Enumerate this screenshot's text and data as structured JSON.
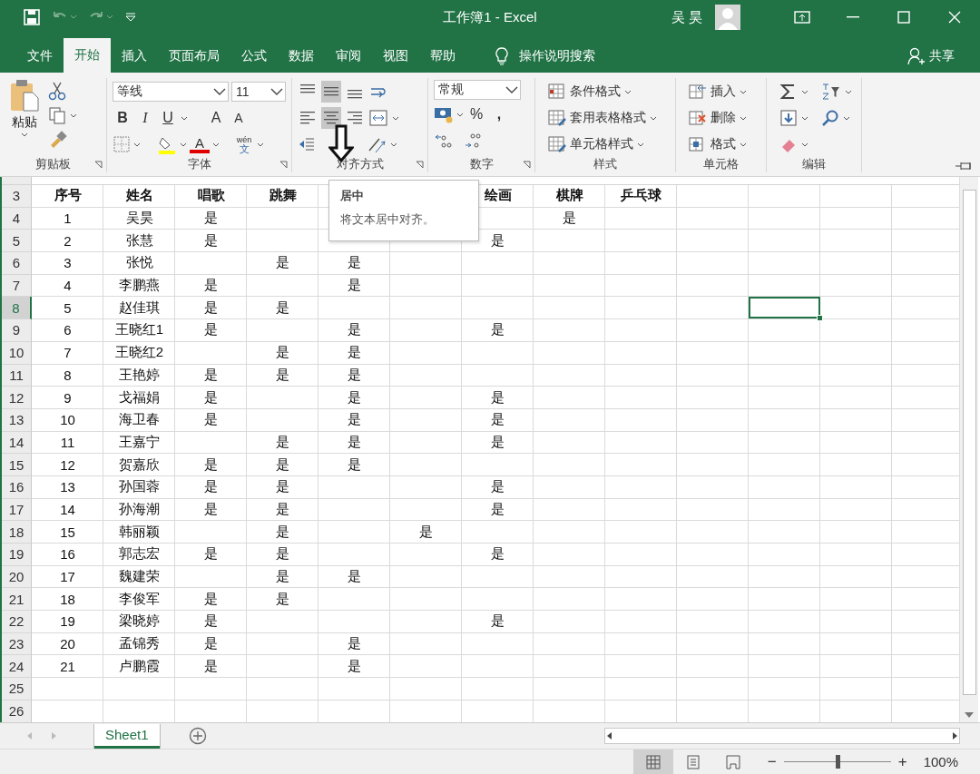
{
  "title_bar": {
    "title": "工作簿1 - Excel",
    "user": "吴昊"
  },
  "menu_tabs": [
    {
      "label": "文件",
      "selected": false
    },
    {
      "label": "开始",
      "selected": true
    },
    {
      "label": "插入",
      "selected": false
    },
    {
      "label": "页面布局",
      "selected": false
    },
    {
      "label": "公式",
      "selected": false
    },
    {
      "label": "数据",
      "selected": false
    },
    {
      "label": "审阅",
      "selected": false
    },
    {
      "label": "视图",
      "selected": false
    },
    {
      "label": "帮助",
      "selected": false
    }
  ],
  "tell_me": "操作说明搜索",
  "share": "共享",
  "ribbon": {
    "clipboard": {
      "label": "剪贴板",
      "paste": "粘贴"
    },
    "font": {
      "label": "字体",
      "font_name": "等线",
      "font_size": "11",
      "bold": "B",
      "italic": "I",
      "underline": "U",
      "grow": "A",
      "shrink": "A",
      "font_color": "A",
      "phonetic_top": "wén",
      "phonetic_bottom": "文"
    },
    "alignment": {
      "label": "对齐方式",
      "vertical": [
        {
          "selected": false
        },
        {
          "selected": true
        },
        {
          "selected": false
        }
      ],
      "horizontal": [
        {
          "selected": false
        },
        {
          "selected": true
        },
        {
          "selected": false
        }
      ]
    },
    "number": {
      "label": "数字",
      "format": "常规",
      "percent": "%",
      "comma": ","
    },
    "styles": {
      "label": "样式",
      "items": [
        "条件格式",
        "套用表格格式",
        "单元格样式"
      ]
    },
    "cells": {
      "label": "单元格",
      "items": [
        "插入",
        "删除",
        "格式"
      ]
    },
    "editing": {
      "label": "编辑"
    }
  },
  "sheet": {
    "header": {
      "label": "3",
      "selected": false,
      "cells": {
        "A": "序号",
        "B": "姓名",
        "C": "唱歌",
        "D": "跳舞",
        "G": "绘画",
        "H": "棋牌",
        "I": "乒乓球"
      }
    },
    "rows": [
      {
        "label": "4",
        "selected": false,
        "cells": {
          "A": "1",
          "B": "吴昊",
          "C": "是",
          "H": "是"
        }
      },
      {
        "label": "5",
        "selected": false,
        "cells": {
          "A": "2",
          "B": "张慧",
          "C": "是",
          "G": "是"
        }
      },
      {
        "label": "6",
        "selected": false,
        "cells": {
          "A": "3",
          "B": "张悦",
          "D": "是",
          "E": "是"
        }
      },
      {
        "label": "7",
        "selected": false,
        "cells": {
          "A": "4",
          "B": "李鹏燕",
          "C": "是",
          "E": "是"
        }
      },
      {
        "label": "8",
        "selected": true,
        "cells": {
          "A": "5",
          "B": "赵佳琪",
          "C": "是",
          "D": "是"
        }
      },
      {
        "label": "9",
        "selected": false,
        "cells": {
          "A": "6",
          "B": "王晓红1",
          "C": "是",
          "E": "是",
          "G": "是"
        }
      },
      {
        "label": "10",
        "selected": false,
        "cells": {
          "A": "7",
          "B": "王晓红2",
          "D": "是",
          "E": "是"
        }
      },
      {
        "label": "11",
        "selected": false,
        "cells": {
          "A": "8",
          "B": "王艳婷",
          "C": "是",
          "D": "是",
          "E": "是"
        }
      },
      {
        "label": "12",
        "selected": false,
        "cells": {
          "A": "9",
          "B": "戈福娟",
          "C": "是",
          "E": "是",
          "G": "是"
        }
      },
      {
        "label": "13",
        "selected": false,
        "cells": {
          "A": "10",
          "B": "海卫春",
          "C": "是",
          "E": "是",
          "G": "是"
        }
      },
      {
        "label": "14",
        "selected": false,
        "cells": {
          "A": "11",
          "B": "王嘉宁",
          "D": "是",
          "E": "是",
          "G": "是"
        }
      },
      {
        "label": "15",
        "selected": false,
        "cells": {
          "A": "12",
          "B": "贺嘉欣",
          "C": "是",
          "D": "是",
          "E": "是"
        }
      },
      {
        "label": "16",
        "selected": false,
        "cells": {
          "A": "13",
          "B": "孙国蓉",
          "C": "是",
          "D": "是",
          "G": "是"
        }
      },
      {
        "label": "17",
        "selected": false,
        "cells": {
          "A": "14",
          "B": "孙海潮",
          "C": "是",
          "D": "是",
          "G": "是"
        }
      },
      {
        "label": "18",
        "selected": false,
        "cells": {
          "A": "15",
          "B": "韩丽颖",
          "D": "是",
          "F": "是"
        }
      },
      {
        "label": "19",
        "selected": false,
        "cells": {
          "A": "16",
          "B": "郭志宏",
          "C": "是",
          "D": "是",
          "G": "是"
        }
      },
      {
        "label": "20",
        "selected": false,
        "cells": {
          "A": "17",
          "B": "魏建荣",
          "D": "是",
          "E": "是"
        }
      },
      {
        "label": "21",
        "selected": false,
        "cells": {
          "A": "18",
          "B": "李俊军",
          "C": "是",
          "D": "是"
        }
      },
      {
        "label": "22",
        "selected": false,
        "cells": {
          "A": "19",
          "B": "梁晓婷",
          "C": "是",
          "G": "是"
        }
      },
      {
        "label": "23",
        "selected": false,
        "cells": {
          "A": "20",
          "B": "孟锦秀",
          "C": "是",
          "E": "是"
        }
      },
      {
        "label": "24",
        "selected": false,
        "cells": {
          "A": "21",
          "B": "卢鹏霞",
          "C": "是",
          "E": "是"
        }
      },
      {
        "label": "25",
        "selected": false,
        "cells": {}
      },
      {
        "label": "26",
        "selected": false,
        "cells": {}
      }
    ]
  },
  "tooltip": {
    "title": "居中",
    "text": "将文本居中对齐。"
  },
  "sheet_tabs": [
    {
      "label": "Sheet1",
      "selected": true
    }
  ],
  "status_bar": {
    "views": [
      {
        "selected": true
      },
      {
        "selected": false
      },
      {
        "selected": false
      }
    ],
    "zoom_out": "−",
    "zoom_in": "+",
    "zoom": {
      "level": 0.5
    },
    "zoom_text": "100%"
  }
}
